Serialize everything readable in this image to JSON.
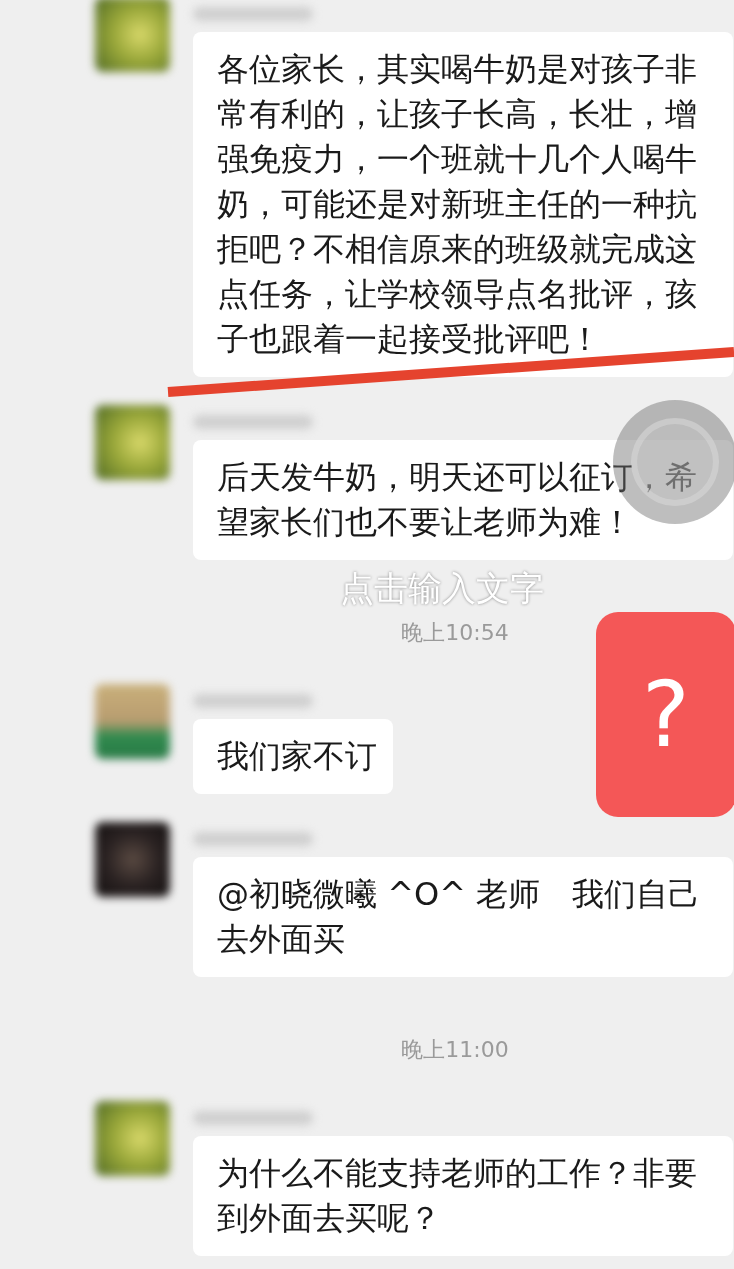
{
  "chat": [
    {
      "kind": "message",
      "text": "各位家长，其实喝牛奶是对孩子非常有利的，让孩子长高，长壮，增强免疫力，一个班就十几个人喝牛奶，可能还是对新班主任的一种抗拒吧？不相信原来的班级就完成这点任务，让学校领导点名批评，孩子也跟着一起接受批评吧！"
    },
    {
      "kind": "message",
      "text": "后天发牛奶，明天还可以征订，希望家长们也不要让老师为难！"
    },
    {
      "kind": "time",
      "text": "晚上10:54"
    },
    {
      "kind": "message",
      "text": "我们家不订"
    },
    {
      "kind": "message",
      "text": "@初晓微曦 ^O^ 老师　我们自己去外面买"
    },
    {
      "kind": "time",
      "text": "晚上11:00"
    },
    {
      "kind": "message",
      "text": "为什么不能支持老师的工作？非要到外面去买呢？"
    }
  ],
  "overlays": {
    "caption": "点击输入文字",
    "sticker": "?"
  }
}
